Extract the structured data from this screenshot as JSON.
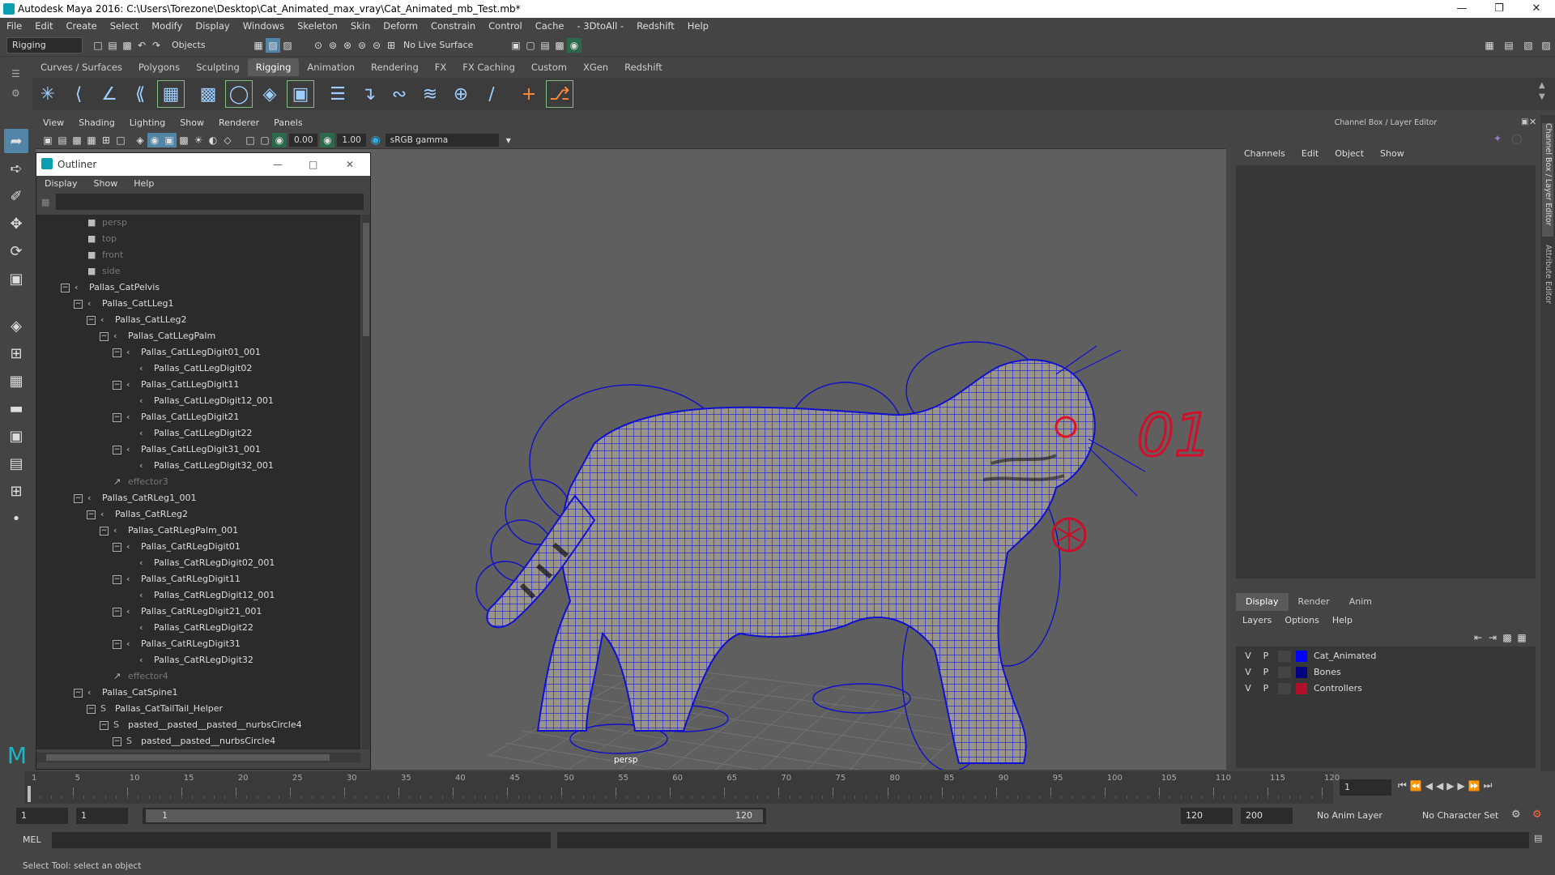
{
  "window": {
    "title": "Autodesk Maya 2016: C:\\Users\\Torezone\\Desktop\\Cat_Animated_max_vray\\Cat_Animated_mb_Test.mb*"
  },
  "menu": [
    "File",
    "Edit",
    "Create",
    "Select",
    "Modify",
    "Display",
    "Windows",
    "Skeleton",
    "Skin",
    "Deform",
    "Constrain",
    "Control",
    "Cache",
    "- 3DtoAll -",
    "Redshift",
    "Help"
  ],
  "status": {
    "menuset": "Rigging",
    "objects_label": "Objects",
    "live_surface": "No Live Surface"
  },
  "shelf": {
    "tabs": [
      "Curves / Surfaces",
      "Polygons",
      "Sculpting",
      "Rigging",
      "Animation",
      "Rendering",
      "FX",
      "FX Caching",
      "Custom",
      "XGen",
      "Redshift"
    ],
    "active": "Rigging"
  },
  "viewport": {
    "menu": [
      "View",
      "Shading",
      "Lighting",
      "Show",
      "Renderer",
      "Panels"
    ],
    "field_a": "0.00",
    "field_b": "1.00",
    "colorspace": "sRGB gamma",
    "camera": "persp",
    "annotation": "01"
  },
  "outliner": {
    "title": "Outliner",
    "menu": [
      "Display",
      "Show",
      "Help"
    ],
    "nodes": [
      {
        "label": "persp",
        "depth": 2,
        "icon": "camera-icon",
        "dim": true,
        "ex": ""
      },
      {
        "label": "top",
        "depth": 2,
        "icon": "camera-icon",
        "dim": true,
        "ex": ""
      },
      {
        "label": "front",
        "depth": 2,
        "icon": "camera-icon",
        "dim": true,
        "ex": ""
      },
      {
        "label": "side",
        "depth": 2,
        "icon": "camera-icon",
        "dim": true,
        "ex": ""
      },
      {
        "label": "Pallas_CatPelvis",
        "depth": 1,
        "icon": "joint-icon",
        "dim": false,
        "ex": "−"
      },
      {
        "label": "Pallas_CatLLeg1",
        "depth": 2,
        "icon": "joint-icon",
        "dim": false,
        "ex": "−"
      },
      {
        "label": "Pallas_CatLLeg2",
        "depth": 3,
        "icon": "joint-icon",
        "dim": false,
        "ex": "−"
      },
      {
        "label": "Pallas_CatLLegPalm",
        "depth": 4,
        "icon": "joint-icon",
        "dim": false,
        "ex": "−"
      },
      {
        "label": "Pallas_CatLLegDigit01_001",
        "depth": 5,
        "icon": "joint-icon",
        "dim": false,
        "ex": "−"
      },
      {
        "label": "Pallas_CatLLegDigit02",
        "depth": 6,
        "icon": "joint-icon",
        "dim": false,
        "ex": ""
      },
      {
        "label": "Pallas_CatLLegDigit11",
        "depth": 5,
        "icon": "joint-icon",
        "dim": false,
        "ex": "−"
      },
      {
        "label": "Pallas_CatLLegDigit12_001",
        "depth": 6,
        "icon": "joint-icon",
        "dim": false,
        "ex": ""
      },
      {
        "label": "Pallas_CatLLegDigit21",
        "depth": 5,
        "icon": "joint-icon",
        "dim": false,
        "ex": "−"
      },
      {
        "label": "Pallas_CatLLegDigit22",
        "depth": 6,
        "icon": "joint-icon",
        "dim": false,
        "ex": ""
      },
      {
        "label": "Pallas_CatLLegDigit31_001",
        "depth": 5,
        "icon": "joint-icon",
        "dim": false,
        "ex": "−"
      },
      {
        "label": "Pallas_CatLLegDigit32_001",
        "depth": 6,
        "icon": "joint-icon",
        "dim": false,
        "ex": ""
      },
      {
        "label": "effector3",
        "depth": 4,
        "icon": "effector-icon",
        "dim": true,
        "ex": ""
      },
      {
        "label": "Pallas_CatRLeg1_001",
        "depth": 2,
        "icon": "joint-icon",
        "dim": false,
        "ex": "−"
      },
      {
        "label": "Pallas_CatRLeg2",
        "depth": 3,
        "icon": "joint-icon",
        "dim": false,
        "ex": "−"
      },
      {
        "label": "Pallas_CatRLegPalm_001",
        "depth": 4,
        "icon": "joint-icon",
        "dim": false,
        "ex": "−"
      },
      {
        "label": "Pallas_CatRLegDigit01",
        "depth": 5,
        "icon": "joint-icon",
        "dim": false,
        "ex": "−"
      },
      {
        "label": "Pallas_CatRLegDigit02_001",
        "depth": 6,
        "icon": "joint-icon",
        "dim": false,
        "ex": ""
      },
      {
        "label": "Pallas_CatRLegDigit11",
        "depth": 5,
        "icon": "joint-icon",
        "dim": false,
        "ex": "−"
      },
      {
        "label": "Pallas_CatRLegDigit12_001",
        "depth": 6,
        "icon": "joint-icon",
        "dim": false,
        "ex": ""
      },
      {
        "label": "Pallas_CatRLegDigit21_001",
        "depth": 5,
        "icon": "joint-icon",
        "dim": false,
        "ex": "−"
      },
      {
        "label": "Pallas_CatRLegDigit22",
        "depth": 6,
        "icon": "joint-icon",
        "dim": false,
        "ex": ""
      },
      {
        "label": "Pallas_CatRLegDigit31",
        "depth": 5,
        "icon": "joint-icon",
        "dim": false,
        "ex": "−"
      },
      {
        "label": "Pallas_CatRLegDigit32",
        "depth": 6,
        "icon": "joint-icon",
        "dim": false,
        "ex": ""
      },
      {
        "label": "effector4",
        "depth": 4,
        "icon": "effector-icon",
        "dim": true,
        "ex": ""
      },
      {
        "label": "Pallas_CatSpine1",
        "depth": 2,
        "icon": "joint-icon",
        "dim": false,
        "ex": "−"
      },
      {
        "label": "Pallas_CatTailTail_Helper",
        "depth": 3,
        "icon": "curve-icon",
        "dim": false,
        "ex": "−"
      },
      {
        "label": "pasted__pasted__pasted__nurbsCircle4",
        "depth": 4,
        "icon": "curve-icon",
        "dim": false,
        "ex": "−"
      },
      {
        "label": "pasted__pasted__nurbsCircle4",
        "depth": 5,
        "icon": "curve-icon",
        "dim": false,
        "ex": "−"
      }
    ]
  },
  "channelbox": {
    "title": "Channel Box / Layer Editor",
    "menu": [
      "Channels",
      "Edit",
      "Object",
      "Show"
    ],
    "side_tabs": [
      "Channel Box / Layer Editor",
      "Attribute Editor"
    ]
  },
  "layer_editor": {
    "tabs": [
      "Display",
      "Render",
      "Anim"
    ],
    "active": "Display",
    "menu": [
      "Layers",
      "Options",
      "Help"
    ],
    "layers": [
      {
        "v": "V",
        "p": "P",
        "name": "Cat_Animated",
        "color": "#0000ff"
      },
      {
        "v": "V",
        "p": "P",
        "name": "Bones",
        "color": "#000080"
      },
      {
        "v": "V",
        "p": "P",
        "name": "Controllers",
        "color": "#b0102a"
      }
    ]
  },
  "timeline": {
    "ticks": [
      1,
      5,
      10,
      15,
      20,
      25,
      30,
      35,
      40,
      45,
      50,
      55,
      60,
      65,
      70,
      75,
      80,
      85,
      90,
      95,
      100,
      105,
      110,
      115,
      120
    ],
    "current_frame": "1"
  },
  "range": {
    "start": "1",
    "anim_start": "1",
    "range_in": "1",
    "range_out": "120",
    "end": "120",
    "anim_end": "200",
    "anim_layer": "No Anim Layer",
    "char_set": "No Character Set"
  },
  "cmd": {
    "label": "MEL"
  },
  "help": {
    "text": "Select Tool: select an object"
  }
}
